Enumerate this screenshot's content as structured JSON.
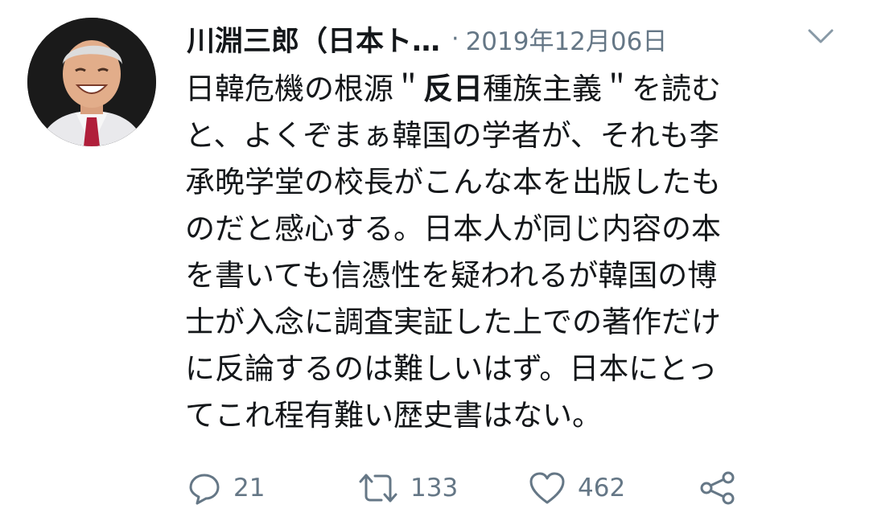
{
  "tweet": {
    "author_name": "川淵三郎（日本ト…",
    "separator": "·",
    "timestamp": "2019年12月06日",
    "body_lines": [
      {
        "pre": "日韓危機の根源＂",
        "bold": "反日",
        "post": "種族主義＂を読む"
      },
      {
        "text": "と、よくぞまぁ韓国の学者が、それも李"
      },
      {
        "text": "承晩学堂の校長がこんな本を出版したも"
      },
      {
        "text": "のだと感心する。日本人が同じ内容の本"
      },
      {
        "text": "を書いても信憑性を疑われるが韓国の博"
      },
      {
        "text": "士が入念に調査実証した上での著作だけ"
      },
      {
        "text": "に反論するのは難しいはず。日本にとっ"
      },
      {
        "text": "てこれ程有難い歴史書はない。"
      }
    ],
    "actions": {
      "reply": {
        "icon": "reply-icon",
        "count": "21"
      },
      "retweet": {
        "icon": "retweet-icon",
        "count": "133"
      },
      "like": {
        "icon": "heart-icon",
        "count": "462"
      },
      "share": {
        "icon": "share-icon"
      }
    }
  },
  "colors": {
    "text": "#14171a",
    "secondary": "#657786"
  }
}
